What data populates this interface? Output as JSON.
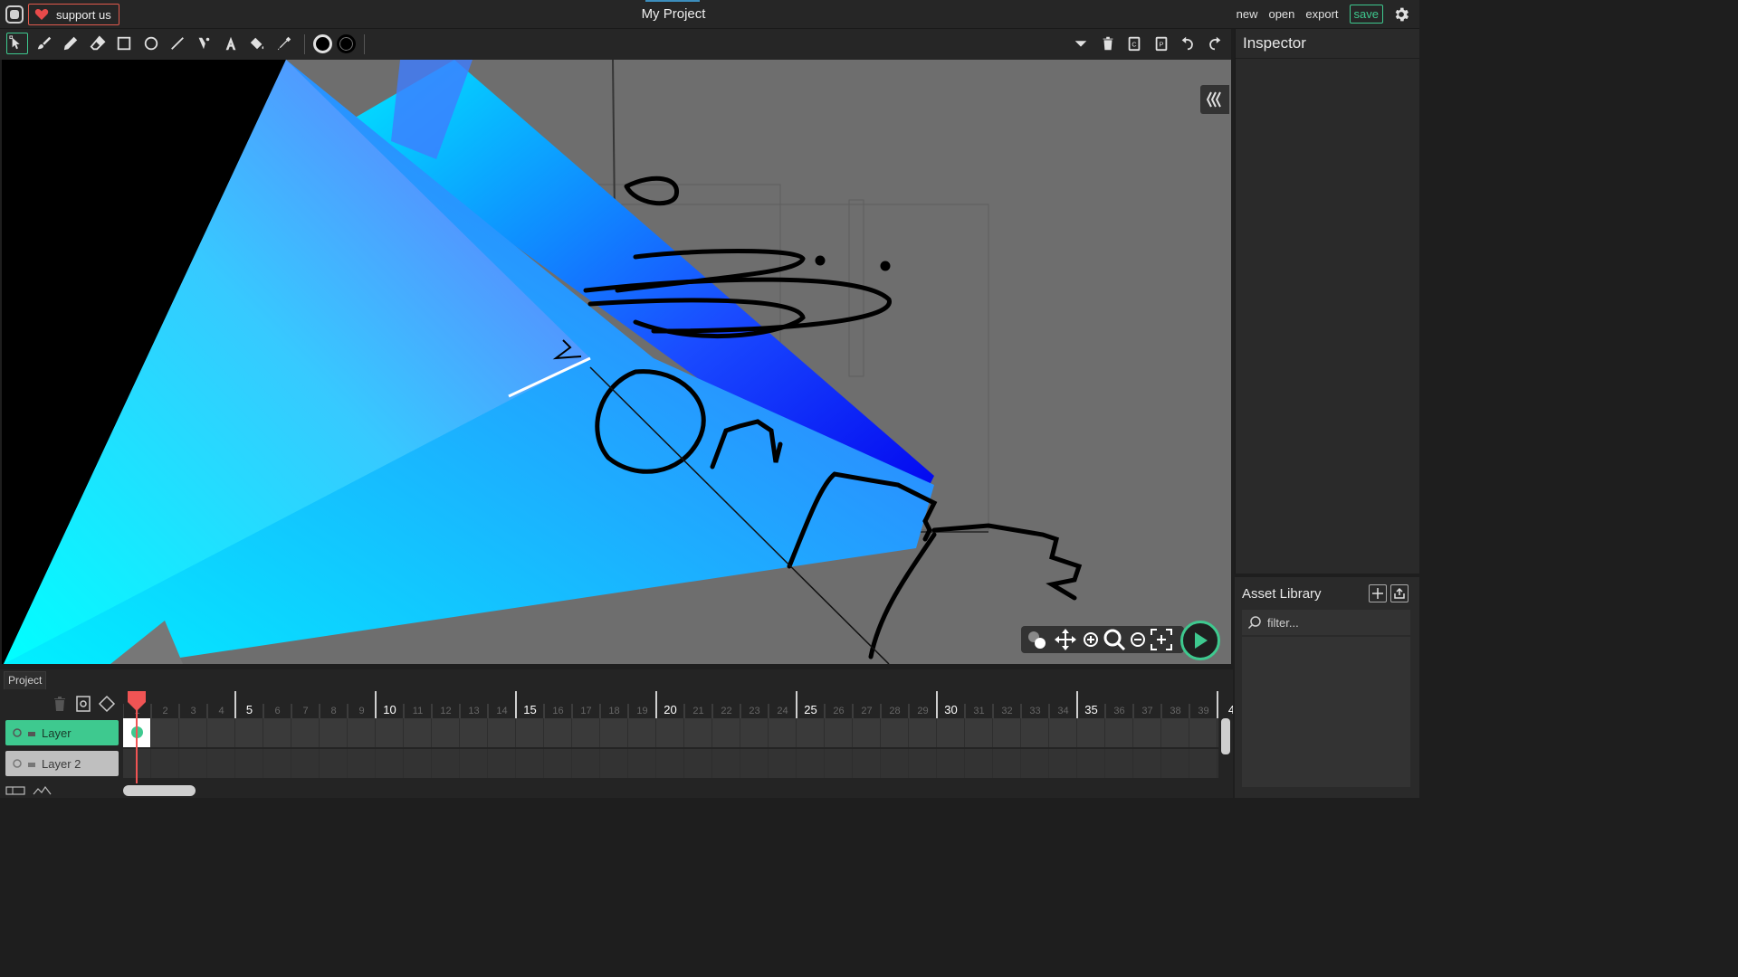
{
  "topbar": {
    "support_label": "support us",
    "title": "My Project",
    "menu": {
      "new": "new",
      "open": "open",
      "export": "export",
      "save": "save"
    }
  },
  "toolbar": {
    "tools": [
      "select-icon",
      "brush-icon",
      "pencil-icon",
      "eraser-icon",
      "rectangle-icon",
      "ellipse-icon",
      "line-icon",
      "path-icon",
      "text-icon",
      "fill-icon",
      "eyedropper-icon"
    ],
    "active_tool": "select-icon",
    "fill_color": "#000000",
    "stroke_color": "#000000",
    "right_tools": [
      "dropdown-icon",
      "delete-icon",
      "copy-icon",
      "paste-icon",
      "undo-icon",
      "redo-icon"
    ]
  },
  "inspector": {
    "title": "Inspector"
  },
  "assets": {
    "title": "Asset Library",
    "filter_placeholder": "filter..."
  },
  "timeline": {
    "tab": "Project",
    "layers": [
      {
        "name": "Layer",
        "active": true
      },
      {
        "name": "Layer 2",
        "active": false
      }
    ],
    "frame_labels": [
      "1",
      "2",
      "3",
      "4",
      "5",
      "6",
      "7",
      "8",
      "9",
      "10",
      "11",
      "12",
      "13",
      "14",
      "15",
      "16",
      "17",
      "18",
      "19",
      "20",
      "21",
      "22",
      "23",
      "24",
      "25",
      "26",
      "27",
      "28",
      "29",
      "30",
      "31",
      "32",
      "33",
      "34",
      "35",
      "36",
      "37",
      "38",
      "39",
      "4"
    ],
    "major_every": 5,
    "current_frame": 1
  },
  "colors": {
    "accent": "#3ec98f",
    "support_border": "#e05a4d",
    "playhead": "#f05454",
    "canvas_bg": "#6e6e6e"
  }
}
